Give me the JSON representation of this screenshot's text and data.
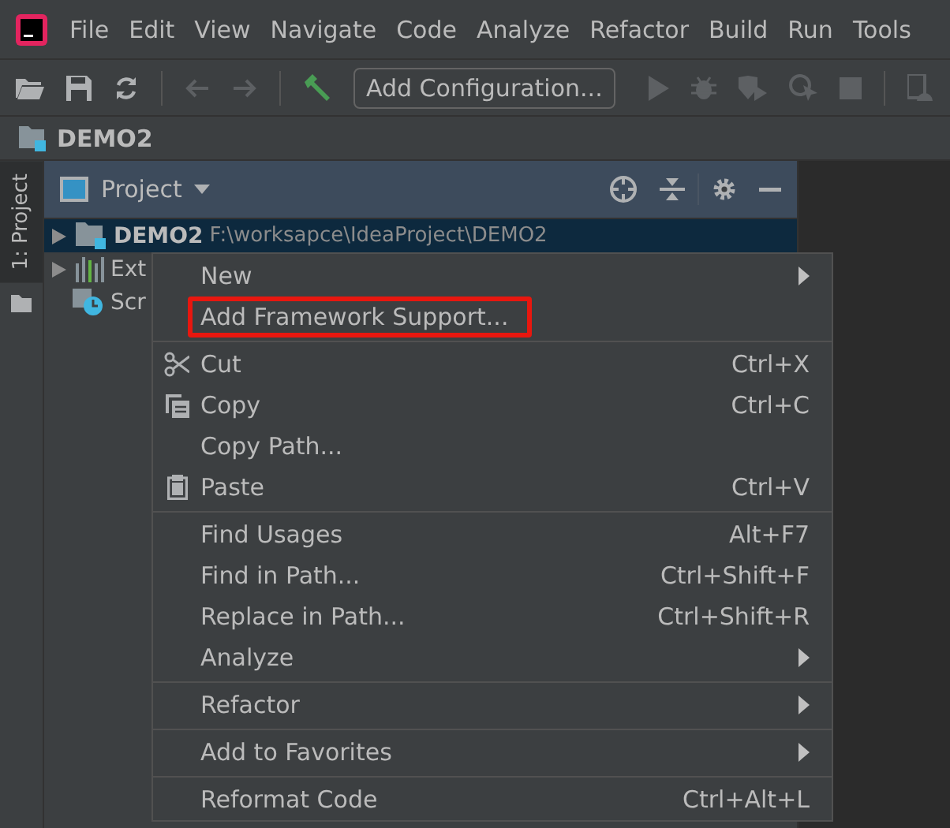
{
  "menu_bar": [
    "File",
    "Edit",
    "View",
    "Navigate",
    "Code",
    "Analyze",
    "Refactor",
    "Build",
    "Run",
    "Tools"
  ],
  "toolbar": {
    "configuration": "Add Configuration..."
  },
  "nav_bar": {
    "project": "DEMO2"
  },
  "tool_stripe": {
    "label": "1: Project"
  },
  "project_panel": {
    "title": "Project",
    "tree": [
      {
        "label": "DEMO2",
        "path": "F:\\worksapce\\IdeaProject\\DEMO2",
        "selected": true,
        "expanded": false
      },
      {
        "label": "Ext",
        "selected": false,
        "expanded": false
      },
      {
        "label": "Scr",
        "selected": false
      }
    ]
  },
  "context_menu": [
    {
      "kind": "item",
      "label": "New",
      "submenu": true,
      "highlighted": false
    },
    {
      "kind": "item",
      "label": "Add Framework Support...",
      "highlighted": true
    },
    {
      "kind": "separator"
    },
    {
      "kind": "item",
      "label": "Cut",
      "shortcut": "Ctrl+X",
      "highlighted": false
    },
    {
      "kind": "item",
      "label": "Copy",
      "shortcut": "Ctrl+C",
      "highlighted": false
    },
    {
      "kind": "item",
      "label": "Copy Path...",
      "highlighted": false
    },
    {
      "kind": "item",
      "label": "Paste",
      "shortcut": "Ctrl+V",
      "highlighted": false
    },
    {
      "kind": "separator"
    },
    {
      "kind": "item",
      "label": "Find Usages",
      "shortcut": "Alt+F7",
      "highlighted": false
    },
    {
      "kind": "item",
      "label": "Find in Path...",
      "shortcut": "Ctrl+Shift+F",
      "highlighted": false
    },
    {
      "kind": "item",
      "label": "Replace in Path...",
      "shortcut": "Ctrl+Shift+R",
      "highlighted": false
    },
    {
      "kind": "item",
      "label": "Analyze",
      "submenu": true,
      "highlighted": false
    },
    {
      "kind": "separator"
    },
    {
      "kind": "item",
      "label": "Refactor",
      "submenu": true,
      "highlighted": false
    },
    {
      "kind": "separator"
    },
    {
      "kind": "item",
      "label": "Add to Favorites",
      "submenu": true,
      "highlighted": false
    },
    {
      "kind": "separator"
    },
    {
      "kind": "item",
      "label": "Reformat Code",
      "shortcut": "Ctrl+Alt+L",
      "highlighted": false
    }
  ]
}
